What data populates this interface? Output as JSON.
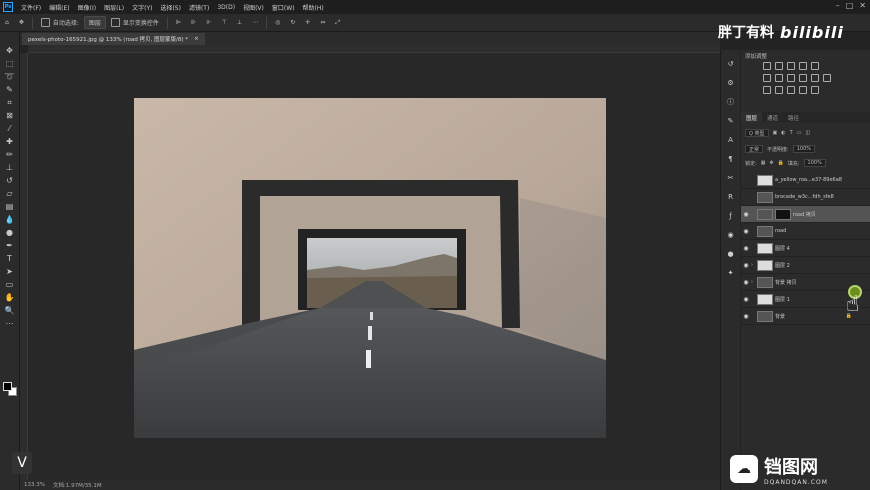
{
  "window": {
    "app_icon": "Ps",
    "menus": [
      "文件(F)",
      "编辑(E)",
      "图像(I)",
      "图层(L)",
      "文字(Y)",
      "选择(S)",
      "滤镜(T)",
      "3D(D)",
      "视图(V)",
      "窗口(W)",
      "帮助(H)"
    ]
  },
  "options_bar": {
    "auto_select_label": "自动选择:",
    "auto_select_value": "图层",
    "show_transform_label": "显示变换控件"
  },
  "document": {
    "tab_title": "pexels-photo-165921.jpg @ 133% (road 拷贝, 图层蒙版/8) *",
    "zoom": "133.3%",
    "doc_size": "文档:1.97M/35.1M"
  },
  "brand": {
    "uploader": "胖丁有料",
    "site": "bilibili"
  },
  "adjustments": {
    "title": "添加调整"
  },
  "layers_panel": {
    "tabs": [
      "图层",
      "通道",
      "路径"
    ],
    "kind_label": "Q 类型",
    "blend_mode": "正常",
    "opacity_label": "不透明度:",
    "opacity_value": "100%",
    "lock_label": "锁定:",
    "fill_label": "填充:",
    "fill_value": "100%",
    "layers": [
      {
        "name": "a_yellow_roa...e37-89e6a8",
        "visible": false,
        "group": false
      },
      {
        "name": "brocade_w3c...fdh_sfe8",
        "visible": false,
        "group": false
      },
      {
        "name": "road 拷贝",
        "visible": true,
        "group": false,
        "selected": true
      },
      {
        "name": "road",
        "visible": true,
        "group": false
      },
      {
        "name": "图层 4",
        "visible": true,
        "group": false
      },
      {
        "name": "图层 2",
        "visible": true,
        "group": true
      },
      {
        "name": "背景 拷贝",
        "visible": true,
        "group": true
      },
      {
        "name": "图层 1",
        "visible": true,
        "group": false
      },
      {
        "name": "背景",
        "visible": true,
        "group": false
      }
    ]
  },
  "watermark": {
    "title": "铛图网",
    "subtitle": "DQANDQAN.COM"
  },
  "badge": "V"
}
